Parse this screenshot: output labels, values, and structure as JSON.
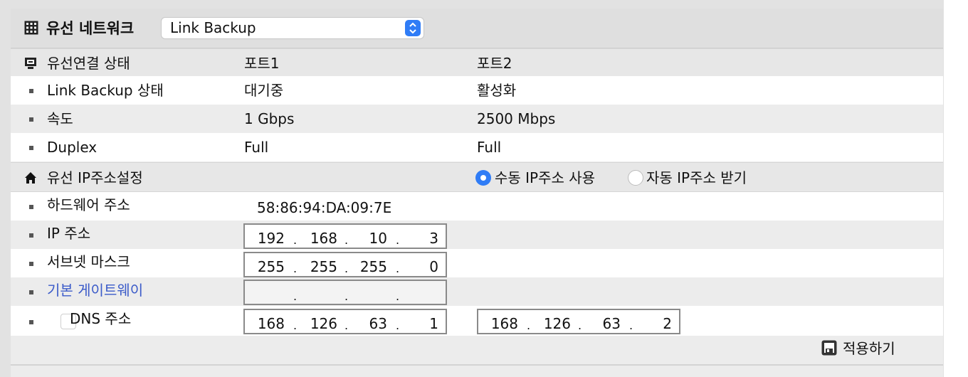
{
  "header": {
    "title": "유선 네트워크",
    "mode_select": "Link Backup",
    "icon": "network-grid-icon"
  },
  "status_section": {
    "title": "유선연결 상태",
    "icon": "monitor-icon",
    "port1": "포트1",
    "port2": "포트2",
    "rows": [
      {
        "label": "Link Backup 상태",
        "port1": "대기중",
        "port2": "활성화"
      },
      {
        "label": "속도",
        "port1": "1 Gbps",
        "port2": "2500 Mbps"
      },
      {
        "label": "Duplex",
        "port1": "Full",
        "port2": "Full"
      }
    ]
  },
  "ip_section": {
    "title": "유선 IP주소설정",
    "icon": "home-icon",
    "manual_label": "수동 IP주소 사용",
    "auto_label": "자동 IP주소 받기",
    "manual_selected": true
  },
  "ip_settings": {
    "hw_label": "하드웨어 주소",
    "hw_value": "58:86:94:DA:09:7E",
    "ip_label": "IP 주소",
    "ip": [
      "192",
      "168",
      "10",
      "3"
    ],
    "subnet_label": "서브넷 마스크",
    "subnet": [
      "255",
      "255",
      "255",
      "0"
    ],
    "gateway_label": "기본 게이트웨이",
    "gateway": [
      "",
      "",
      "",
      ""
    ],
    "dns_label": "DNS 주소",
    "dns_checked": false,
    "dns1": [
      "168",
      "126",
      "63",
      "1"
    ],
    "dns2": [
      "168",
      "126",
      "63",
      "2"
    ]
  },
  "apply_label": "적용하기",
  "colors": {
    "accent": "#2f7cf6",
    "link": "#3b5bc9"
  }
}
